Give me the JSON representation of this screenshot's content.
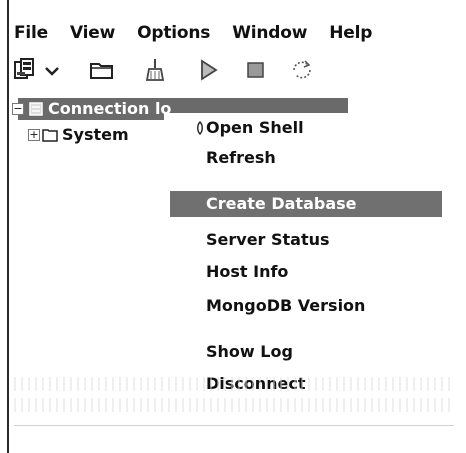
{
  "menubar": {
    "items": [
      "File",
      "View",
      "Options",
      "Window",
      "Help"
    ]
  },
  "toolbar": {
    "buttons": [
      {
        "icon": "connect-icon"
      },
      {
        "icon": "dropdown-arrow-icon"
      },
      {
        "icon": "folder-icon"
      },
      {
        "icon": "broom-icon"
      },
      {
        "icon": "play-icon"
      },
      {
        "icon": "stop-icon"
      },
      {
        "icon": "refresh-icon"
      }
    ]
  },
  "tree": {
    "nodes": [
      {
        "label": "Connection lo",
        "icon": "server-icon",
        "expanded": true,
        "selected": true
      },
      {
        "label": "System",
        "icon": "folder-icon",
        "expanded": false,
        "selected": false
      }
    ]
  },
  "context_menu": {
    "items": [
      {
        "label": "Open Shell",
        "icon": "shell-icon"
      },
      {
        "label": "Refresh"
      },
      {
        "label": "Create Database",
        "active": true
      },
      {
        "label": "Server Status"
      },
      {
        "label": "Host Info"
      },
      {
        "label": "MongoDB Version"
      },
      {
        "label": "Show Log"
      },
      {
        "label": "Disconnect"
      }
    ]
  },
  "colors": {
    "selection": "#6a6a6a",
    "highlight": "#707070",
    "text": "#111111"
  }
}
